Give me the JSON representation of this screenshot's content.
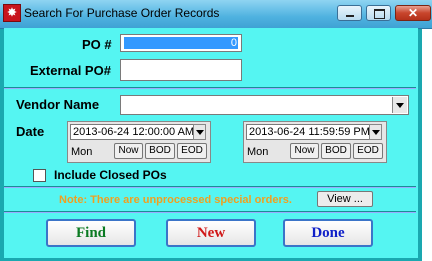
{
  "window": {
    "title": "Search For Purchase Order Records",
    "app_icon_glyph": "✸",
    "close_glyph": "✕"
  },
  "form": {
    "po_label": "PO #",
    "po_value": "0",
    "external_po_label": "External PO#",
    "external_po_value": "",
    "vendor_label": "Vendor Name",
    "vendor_value": "",
    "date_label": "Date",
    "date_from": {
      "value": "2013-06-24 12:00:00 AM",
      "day": "Mon"
    },
    "date_to": {
      "value": "2013-06-24 11:59:59 PM",
      "day": "Mon"
    },
    "quick_buttons": [
      "Now",
      "BOD",
      "EOD"
    ],
    "include_closed_label": "Include Closed POs",
    "include_closed_checked": false,
    "note": "Note: There are unprocessed special orders.",
    "view_label": "View ..."
  },
  "actions": {
    "find": "Find",
    "new": "New",
    "done": "Done"
  },
  "colors": {
    "client_bg": "#55f5f2",
    "frame": "#1aa8b0",
    "note": "#f0a020",
    "find_text": "#0b7a22",
    "new_text": "#d01818",
    "done_text": "#1020c8"
  },
  "icons": {
    "app": "app-icon",
    "dropdown": "chevron-down-icon",
    "checkbox": "checkbox-icon"
  }
}
